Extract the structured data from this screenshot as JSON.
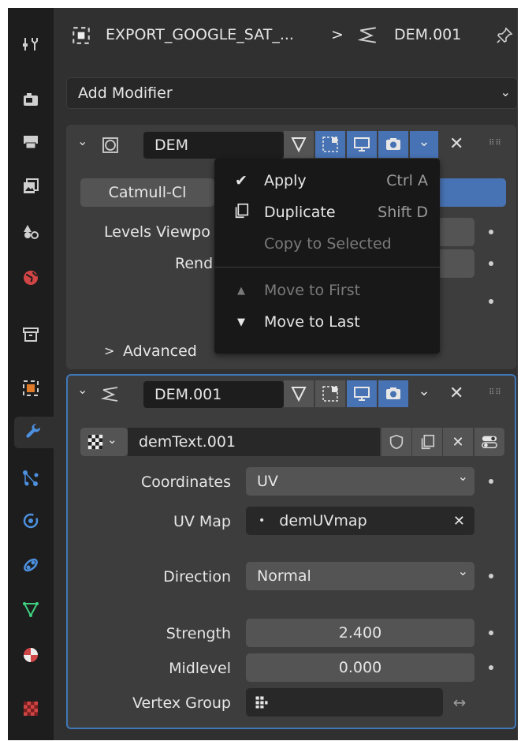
{
  "header": {
    "object_name": "EXPORT_GOOGLE_SAT_...",
    "separator": ">",
    "modifier_name": "DEM.001"
  },
  "add_modifier": {
    "label": "Add Modifier"
  },
  "panel1": {
    "name": "DEM",
    "subdiv_tab": "Catmull-Cl",
    "levels_viewport_label": "Levels Viewpo",
    "render_label": "Rend",
    "advanced_label": "Advanced"
  },
  "context_menu": {
    "items": [
      {
        "label": "Apply",
        "shortcut": "Ctrl A",
        "icon": "check-icon",
        "enabled": true
      },
      {
        "label": "Duplicate",
        "shortcut": "Shift D",
        "icon": "duplicate-icon",
        "enabled": true
      },
      {
        "label": "Copy to Selected",
        "shortcut": "",
        "icon": "",
        "enabled": false
      },
      {
        "label": "Move to First",
        "shortcut": "",
        "icon": "triangle-up-icon",
        "enabled": false
      },
      {
        "label": "Move to Last",
        "shortcut": "",
        "icon": "triangle-down-icon",
        "enabled": true
      }
    ]
  },
  "panel2": {
    "name": "DEM.001",
    "texture_name": "demText.001",
    "coordinates_label": "Coordinates",
    "coordinates_value": "UV",
    "uvmap_label": "UV Map",
    "uvmap_value": "demUVmap",
    "direction_label": "Direction",
    "direction_value": "Normal",
    "strength_label": "Strength",
    "strength_value": "2.400",
    "midlevel_label": "Midlevel",
    "midlevel_value": "0.000",
    "vertex_group_label": "Vertex Group",
    "vertex_group_value": ""
  },
  "colors": {
    "accent": "#4772b3",
    "panel": "#3d3d3d",
    "background": "#303030",
    "tabbar": "#1d1d1d"
  }
}
